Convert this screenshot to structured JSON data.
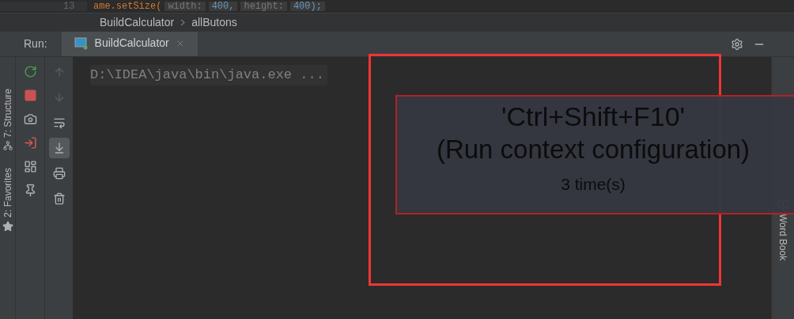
{
  "editor": {
    "line_number": "13",
    "code": "ame.setSize(",
    "hints": [
      {
        "text": "width:",
        "kind": "hint"
      },
      {
        "text": "400,",
        "kind": "number"
      },
      {
        "text": "height:",
        "kind": "hint"
      },
      {
        "text": "400);",
        "kind": "number"
      }
    ]
  },
  "breadcrumbs": [
    "BuildCalculator",
    "allButons"
  ],
  "run_panel": {
    "label": "Run:",
    "tab": {
      "label": "BuildCalculator",
      "selected": true
    }
  },
  "left_stripe": [
    "7: Structure",
    "2: Favorites"
  ],
  "toolbar_1": [
    {
      "kind": "rerun",
      "disabled": false
    },
    {
      "kind": "stop",
      "disabled": false
    },
    {
      "kind": "camera",
      "disabled": false
    },
    {
      "kind": "login",
      "disabled": false
    },
    {
      "kind": "layout",
      "disabled": false
    },
    {
      "kind": "pin",
      "disabled": false
    }
  ],
  "toolbar_2": [
    {
      "kind": "up",
      "disabled": true,
      "selected": false
    },
    {
      "kind": "down",
      "disabled": true,
      "selected": false
    },
    {
      "kind": "wrap",
      "disabled": false,
      "selected": false
    },
    {
      "kind": "scroll",
      "disabled": false,
      "selected": true
    },
    {
      "kind": "print",
      "disabled": false,
      "selected": false
    },
    {
      "kind": "trash",
      "disabled": false,
      "selected": false
    }
  ],
  "console": {
    "lines": [
      "D:\\IDEA\\java\\bin\\java.exe ..."
    ]
  },
  "right_stripe": [
    "Word Book"
  ],
  "key_promoter": {
    "shortcut": "'Ctrl+Shift+F10'",
    "action": "(Run context configuration)",
    "count": "3 time(s)"
  }
}
